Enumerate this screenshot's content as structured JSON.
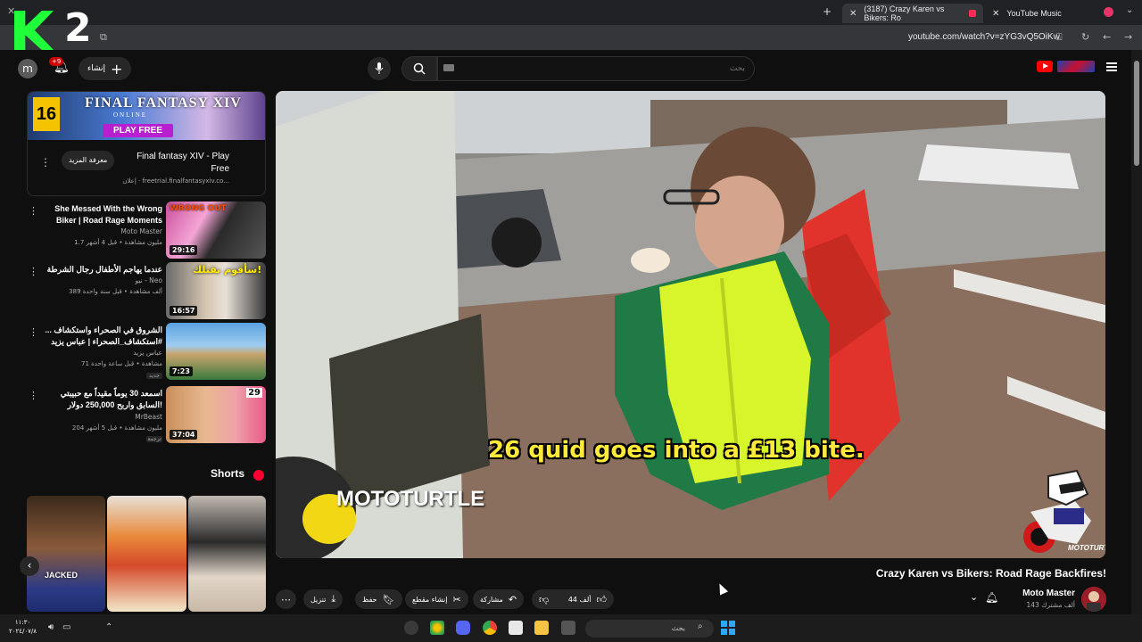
{
  "browser": {
    "tabs": [
      {
        "label": "(3187) Crazy Karen vs Bikers: Ro",
        "active": true
      },
      {
        "label": "YouTube Music",
        "active": false
      }
    ],
    "url": "youtube.com/watch?v=zYG3vQ5OiKw"
  },
  "header": {
    "avatar_letter": "m",
    "notifications_count": "+9",
    "create_label": "إنشاء",
    "search_placeholder": "بحث"
  },
  "ad": {
    "pegi": "16",
    "banner_title": "FINAL FANTASY XIV",
    "banner_sub": "ONLINE",
    "banner_cta": "PLAY FREE",
    "title": "Final fantasy XIV - Play Free",
    "more_label": "معرفة المزيد",
    "url": "إعلان · freetrial.finalfantasyxiv.co..."
  },
  "sidebar_videos": [
    {
      "title": "She Messed With the Wrong Biker | Road Rage Moments",
      "channel": "Moto Master",
      "meta": "1.7 مليون مشاهدة • قبل 4 أشهر",
      "duration": "29:16",
      "badge": ""
    },
    {
      "title": "عندما يهاجم الأطفال رجال الشرطة",
      "channel": "نيو - Neo",
      "meta": "389 ألف مشاهدة • قبل سنة واحدة",
      "duration": "16:57",
      "badge": ""
    },
    {
      "title": "الشروق في الصحراء واستكشاف ... #استكشاف_الصحراء | عباس يزيد",
      "channel": "عباس يزيد",
      "meta": "71 مشاهدة • قبل ساعة واحدة",
      "duration": "7:23",
      "badge": "جديد"
    },
    {
      "title": "اسمعد 30 يوماً مقيداً مع حبيبتي السابق واربح 250,000 دولار!",
      "channel": "MrBeast",
      "meta": "204 مليون مشاهدة • قبل 5 أشهر",
      "duration": "37:04",
      "badge": "ترجمة"
    }
  ],
  "shorts": {
    "heading": "Shorts",
    "first_label": "JACKED"
  },
  "player": {
    "subtitle": "26 quid goes into a £13 bite.",
    "watermark": "MOTOTURTLE",
    "mascot_tag": "MOTOTURTLE"
  },
  "video": {
    "title": "Crazy Karen vs Bikers: Road Rage Backfires!",
    "channel": "Moto Master",
    "subs": "143 ألف مشترك",
    "likes": "44 ألف",
    "share_label": "مشاركة",
    "clip_label": "إنشاء مقطع",
    "save_label": "حفظ",
    "download_label": "تنزيل"
  },
  "taskbar": {
    "time": "١١:٣٠",
    "date": "٢٠٢٤/٠٧/٨",
    "search_placeholder": "بحث"
  },
  "colors": {
    "bg": "#0f0f0f",
    "accent": "#ff0000",
    "subtitle": "#ffea3a"
  }
}
